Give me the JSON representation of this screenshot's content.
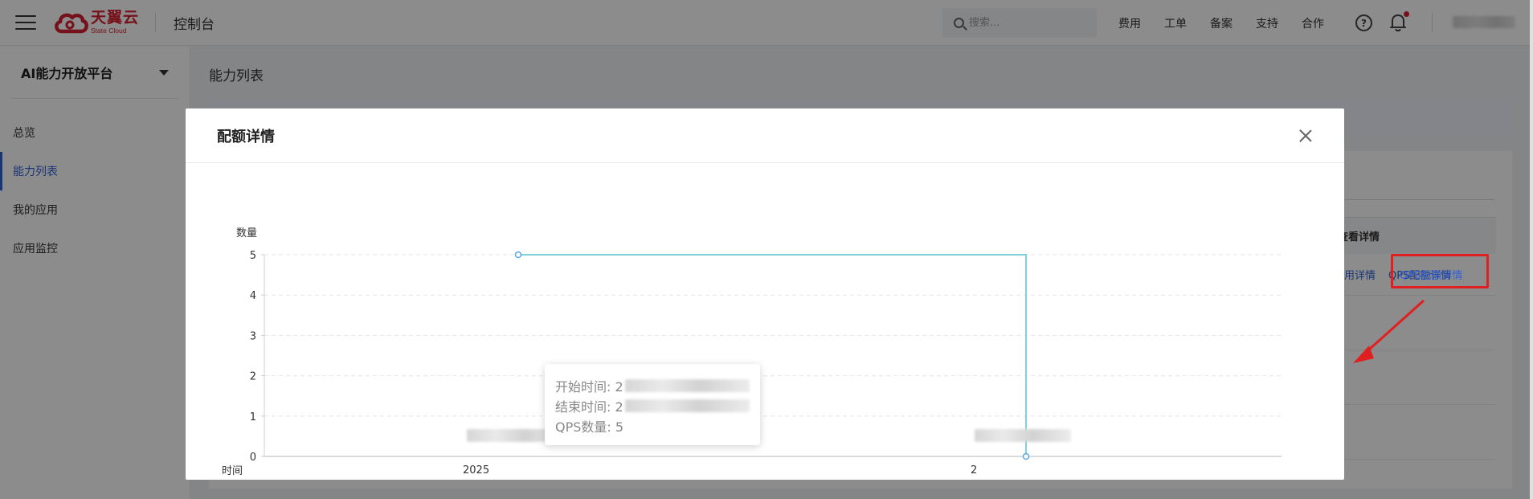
{
  "topbar": {
    "logo_cn": "天翼云",
    "logo_en": "State Cloud",
    "console_title": "控制台",
    "search_placeholder": "搜索...",
    "links": [
      "费用",
      "工单",
      "备案",
      "支持",
      "合作"
    ],
    "help_symbol": "?"
  },
  "sidebar": {
    "platform_name": "AI能力开放平台",
    "items": [
      {
        "label": "总览"
      },
      {
        "label": "能力列表"
      },
      {
        "label": "我的应用"
      },
      {
        "label": "应用监控"
      }
    ]
  },
  "main": {
    "page_title": "能力列表",
    "table_header": "查看详情",
    "row_link_usage": "使用详情",
    "row_link_qps": "QPS配额详情"
  },
  "modal": {
    "title": "配额详情"
  },
  "tooltip": {
    "start_label": "开始时间: 2",
    "end_label": "结束时间: 2",
    "qps_label": "QPS数量: 5"
  },
  "chart_data": {
    "type": "line",
    "ylabel": "数量",
    "xlabel": "时间",
    "ylim": [
      0,
      5
    ],
    "yticks": [
      "0",
      "1",
      "2",
      "3",
      "4",
      "5"
    ],
    "x_tick_labels": [
      "2025",
      "2"
    ],
    "series": [
      {
        "values": [
          5,
          5,
          0
        ]
      }
    ],
    "grid": true
  },
  "colors": {
    "brand_red": "#d81e30",
    "accent_blue": "#3161d8",
    "line_color": "#7fd0d8",
    "highlight_red": "#e02020"
  }
}
